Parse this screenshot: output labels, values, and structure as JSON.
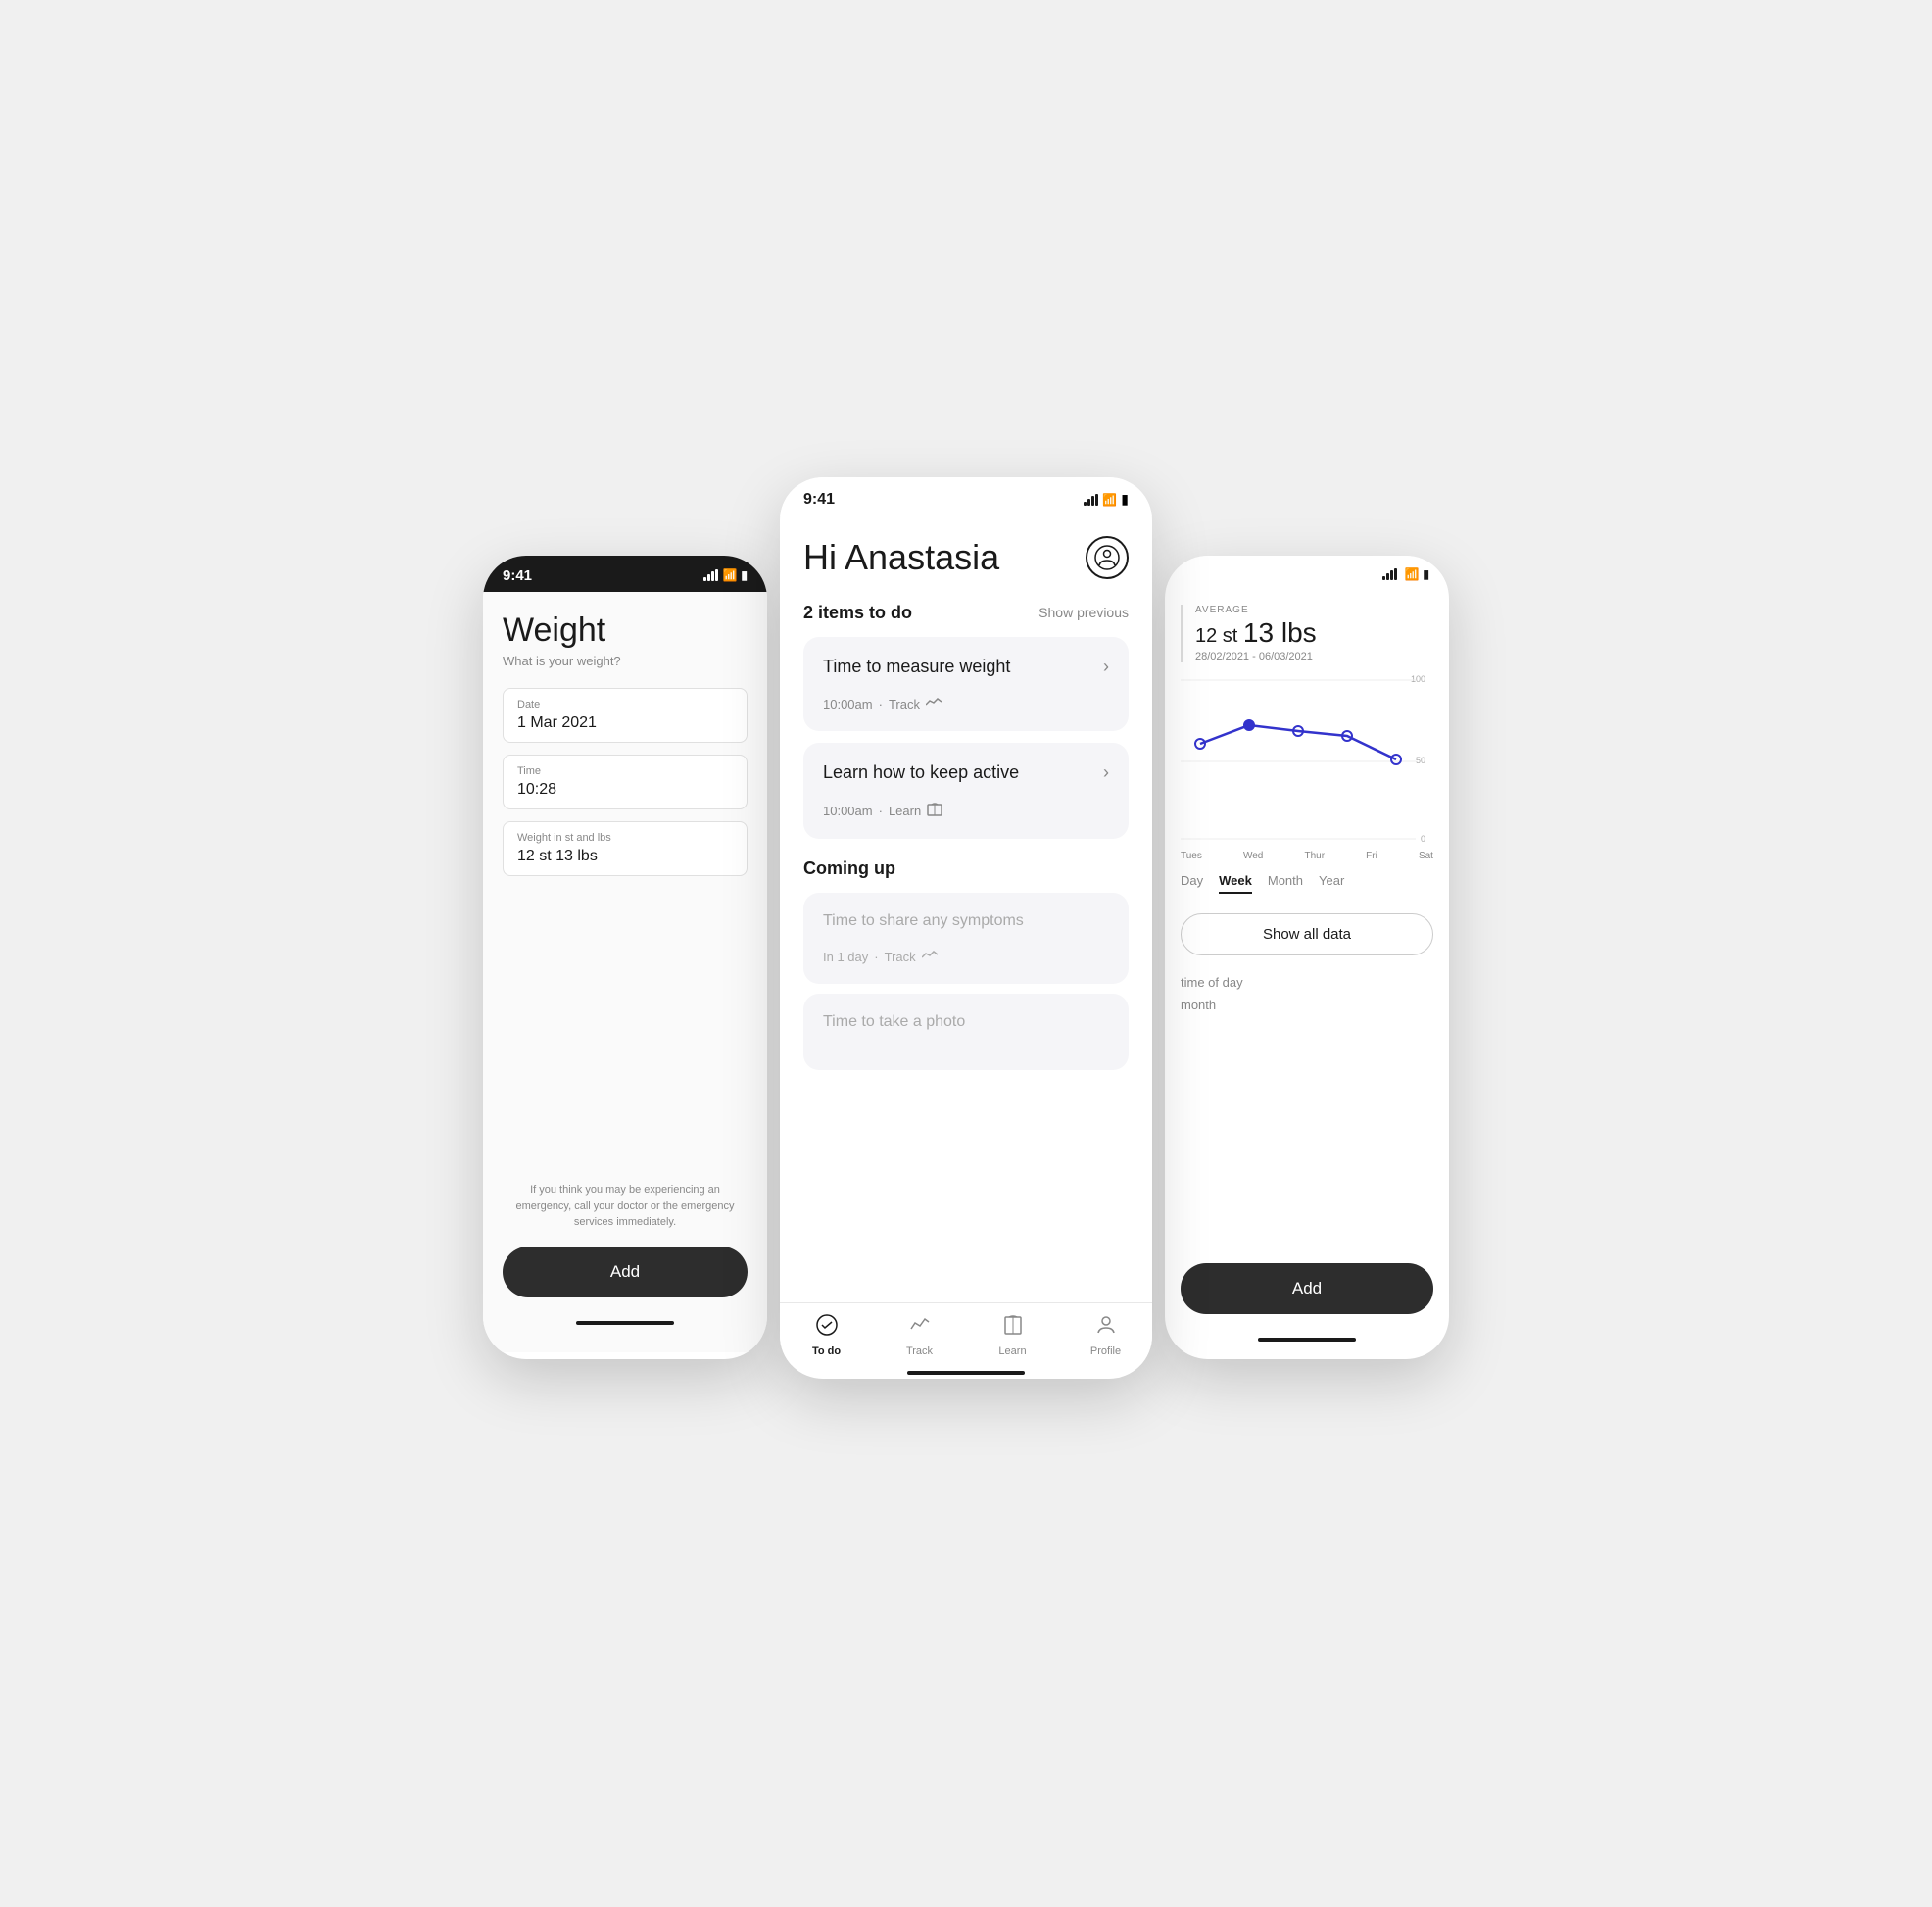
{
  "left_phone": {
    "time": "9:41",
    "page_title": "Weight",
    "page_subtitle": "What is your weight?",
    "fields": [
      {
        "label": "Date",
        "value": "1 Mar 2021"
      },
      {
        "label": "Time",
        "value": "10:28"
      },
      {
        "label": "Weight in st and lbs",
        "value": "12 st 13 lbs"
      }
    ],
    "disclaimer": "If you think you may be experiencing an emergency, call your doctor or the emergency services immediately.",
    "add_button": "Add"
  },
  "right_phone": {
    "average_label": "AVERAGE",
    "average_value_st": "12 st",
    "average_value_lbs": "13 lbs",
    "date_range": "28/02/2021 - 06/03/2021",
    "chart_days": [
      "Tues",
      "Wed",
      "Thur",
      "Fri",
      "Sat"
    ],
    "chart_values": [
      60,
      72,
      68,
      65,
      50
    ],
    "y_axis_max": "100",
    "y_axis_mid": "50",
    "y_axis_min": "0",
    "period_tabs": [
      "Day",
      "Week",
      "Month",
      "Year"
    ],
    "active_period": "Week",
    "show_all_label": "Show all data",
    "filter_labels": [
      "time of day",
      "month"
    ],
    "add_button": "Add"
  },
  "center_phone": {
    "time": "9:41",
    "greeting": "Hi Anastasia",
    "items_count": "2 items to do",
    "show_previous": "Show previous",
    "todo_items": [
      {
        "title": "Time to measure weight",
        "time": "10:00am",
        "type": "Track",
        "icon": "📈"
      },
      {
        "title": "Learn how to keep active",
        "time": "10:00am",
        "type": "Learn",
        "icon": "📖"
      }
    ],
    "coming_up_title": "Coming up",
    "coming_up_items": [
      {
        "title": "Time to share any symptoms",
        "time": "In 1 day",
        "type": "Track"
      },
      {
        "title": "Time to take a photo",
        "time": ""
      }
    ],
    "nav_items": [
      {
        "label": "To do",
        "active": true
      },
      {
        "label": "Track",
        "active": false
      },
      {
        "label": "Learn",
        "active": false
      },
      {
        "label": "Profile",
        "active": false
      }
    ]
  }
}
